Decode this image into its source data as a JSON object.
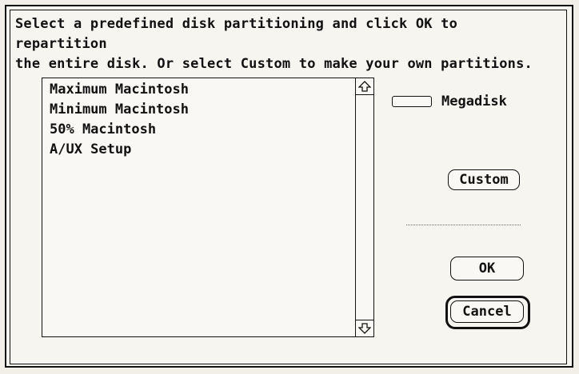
{
  "dialog": {
    "instructions": "Select a predefined disk partitioning and click OK to repartition\nthe entire disk.  Or select Custom to make your own partitions."
  },
  "partition_list": {
    "items": [
      {
        "label": "Maximum Macintosh"
      },
      {
        "label": "Minimum Macintosh"
      },
      {
        "label": "50% Macintosh"
      },
      {
        "label": "A/UX Setup"
      }
    ]
  },
  "drive": {
    "label": "Megadisk",
    "icon": "drive-icon"
  },
  "buttons": {
    "custom_label": "Custom",
    "ok_label": "OK",
    "cancel_label": "Cancel",
    "default_button": "Cancel"
  },
  "icons": {
    "scroll_up": "scroll-up-arrow-icon",
    "scroll_down": "scroll-down-arrow-icon"
  }
}
